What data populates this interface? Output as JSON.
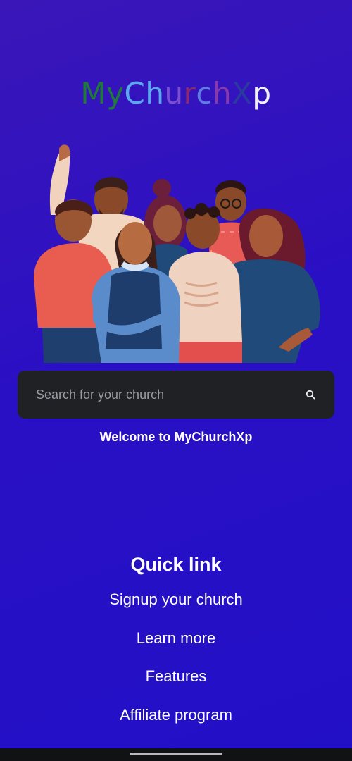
{
  "logo": {
    "letters": [
      {
        "ch": "M",
        "color": "#1f7a3a"
      },
      {
        "ch": "y",
        "color": "#1f7a3a"
      },
      {
        "ch": "C",
        "color": "#5aa8ee"
      },
      {
        "ch": "h",
        "color": "#5aa8ee"
      },
      {
        "ch": "u",
        "color": "#7a4fd0"
      },
      {
        "ch": "r",
        "color": "#8a2a72"
      },
      {
        "ch": "c",
        "color": "#5d7de0"
      },
      {
        "ch": "h",
        "color": "#8a3aa8"
      },
      {
        "ch": "X",
        "color": "#2b3aa0"
      },
      {
        "ch": "p",
        "color": "#f0f0f5"
      }
    ]
  },
  "illustration": {
    "name": "group-of-people-illustration"
  },
  "search": {
    "placeholder": "Search for your church",
    "value": "",
    "icon": "search-icon"
  },
  "welcome_text": "Welcome to MyChurchXp",
  "quick_links": {
    "title": "Quick link",
    "items": [
      {
        "label": "Signup your church"
      },
      {
        "label": "Learn more"
      },
      {
        "label": "Features"
      },
      {
        "label": "Affiliate program"
      }
    ]
  },
  "colors": {
    "background_top": "#3a16b8",
    "background_bottom": "#2210c6",
    "search_bg": "#202125",
    "nav_bar": "#111214"
  }
}
